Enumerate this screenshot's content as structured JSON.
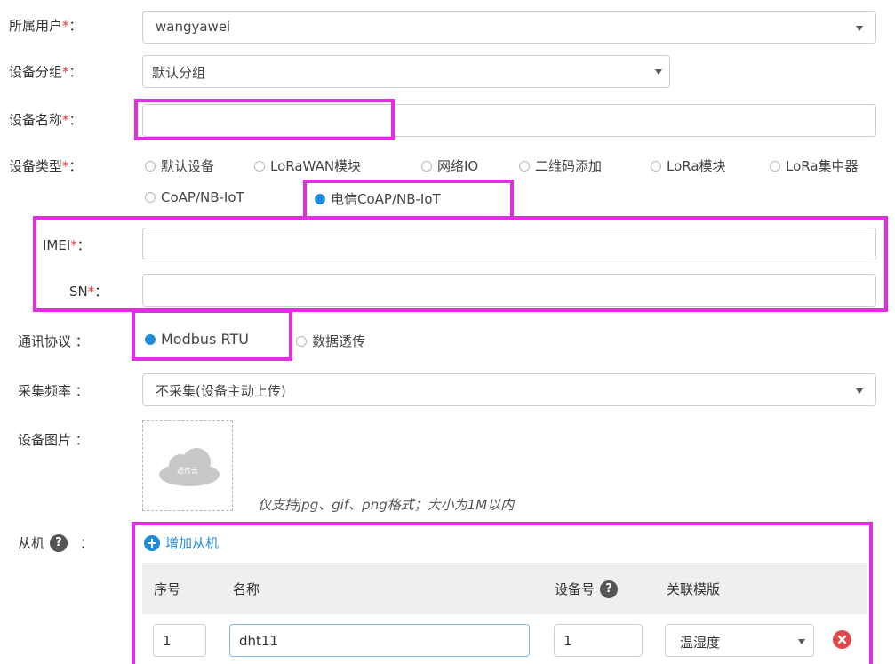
{
  "form": {
    "required_mark": "*",
    "colon": "：",
    "owner": {
      "label": "所属用户",
      "value": "wangyawei"
    },
    "group": {
      "label": "设备分组",
      "value": "默认分组"
    },
    "name": {
      "label": "设备名称",
      "value": ""
    },
    "type": {
      "label": "设备类型",
      "options": [
        "默认设备",
        "LoRaWAN模块",
        "网络IO",
        "二维码添加",
        "LoRa模块",
        "LoRa集中器",
        "CoAP/NB-IoT",
        "电信CoAP/NB-IoT"
      ],
      "selected": "电信CoAP/NB-IoT"
    },
    "imei": {
      "label": "IMEI",
      "value": ""
    },
    "sn": {
      "label": "SN",
      "value": ""
    },
    "protocol": {
      "label": "通讯协议",
      "options": [
        "Modbus RTU",
        "数据透传"
      ],
      "selected": "Modbus RTU"
    },
    "frequency": {
      "label": "采集频率",
      "value": "不采集(设备主动上传)"
    },
    "image": {
      "label": "设备图片",
      "hint": "仅支持jpg、gif、png格式；大小为1M以内",
      "placeholder_text": "透传云"
    },
    "slave": {
      "label": "从机",
      "help_icon": "?",
      "add_label": "增加从机",
      "columns": [
        "序号",
        "名称",
        "设备号",
        "关联模版"
      ],
      "rows": [
        {
          "index": "1",
          "name": "dht11",
          "device_no": "1",
          "template": "温湿度"
        }
      ]
    }
  },
  "colors": {
    "highlight": "#e22ee3",
    "accent": "#1f8ad8",
    "required": "#e5322f",
    "delete": "#e2474b"
  }
}
